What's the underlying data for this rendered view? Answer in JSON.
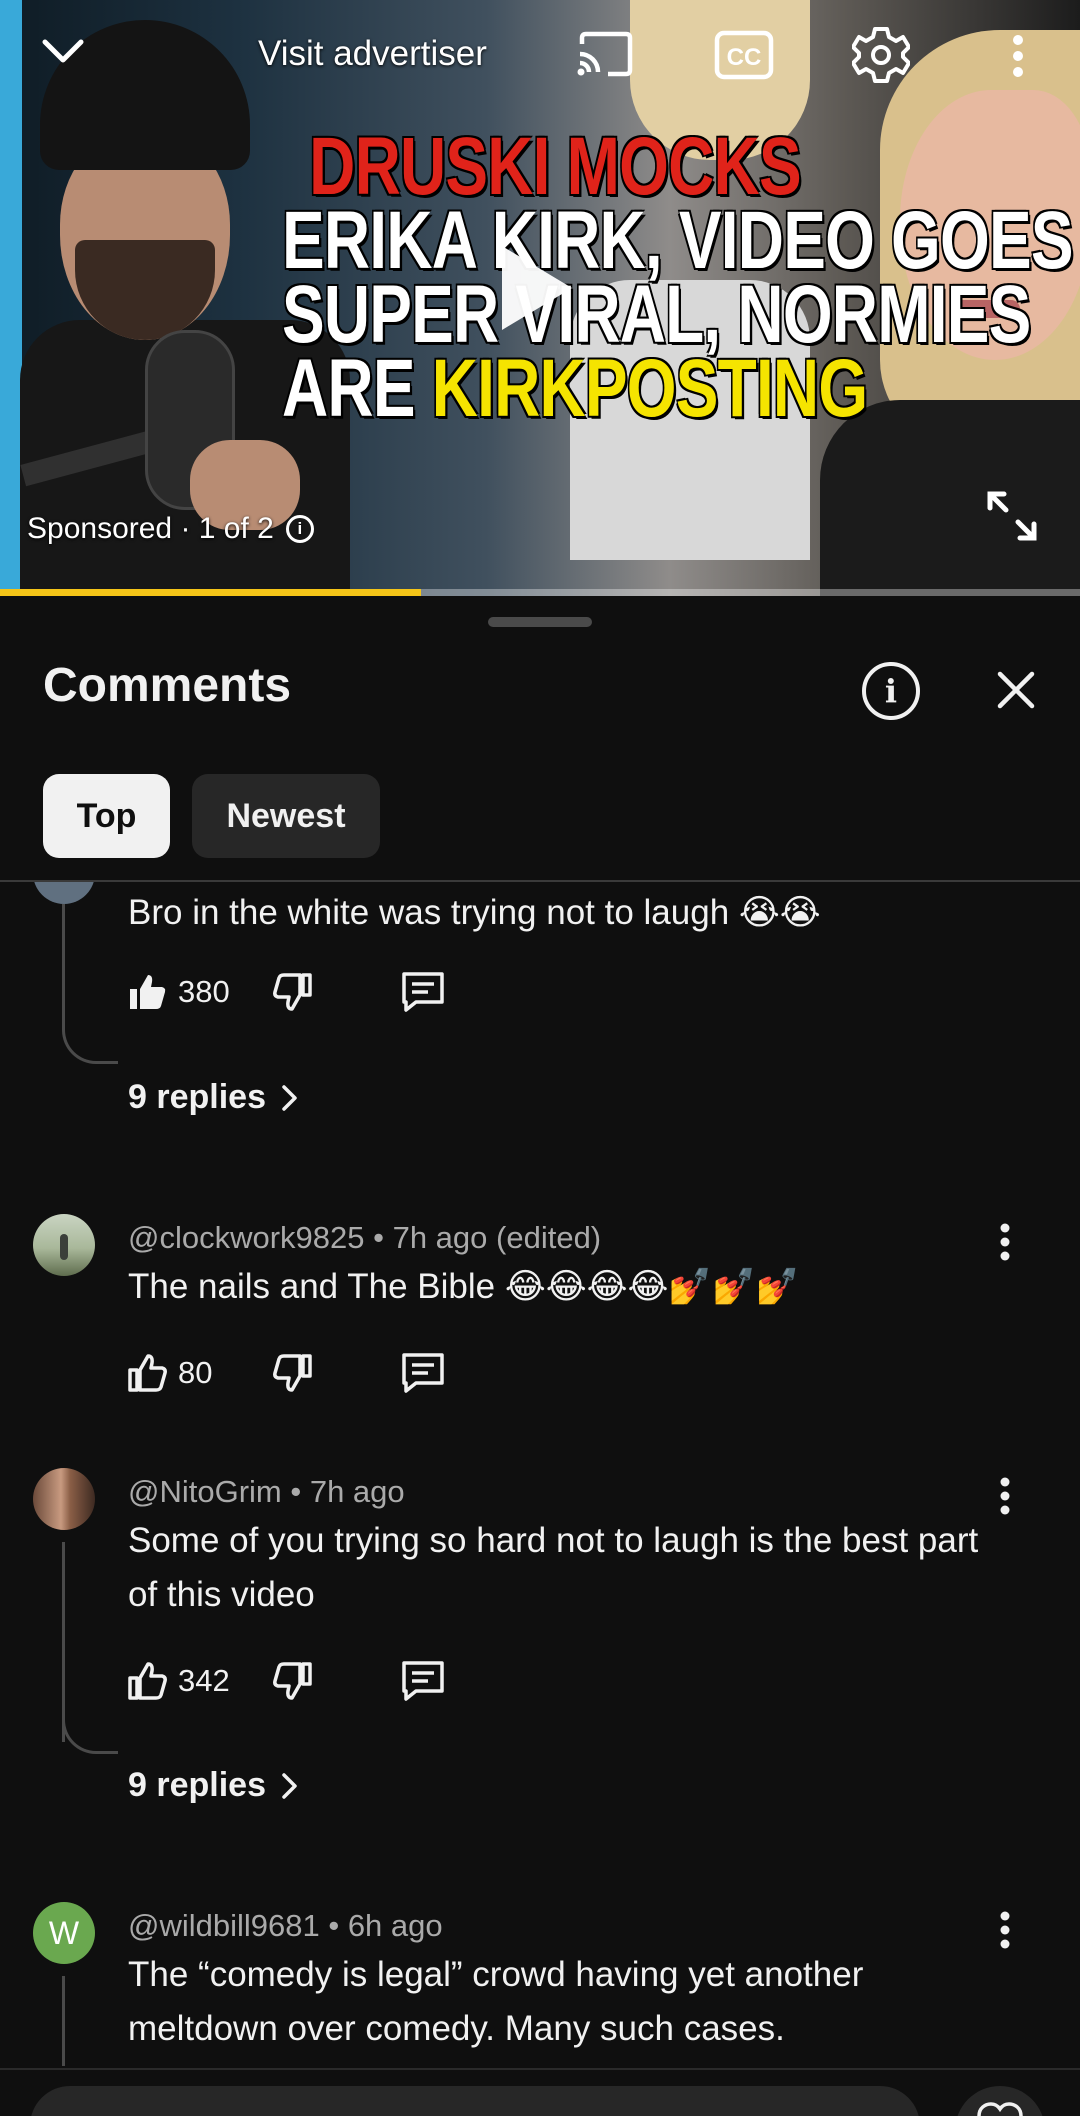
{
  "player": {
    "visit_advertiser": "Visit advertiser",
    "headline": {
      "line1": "DRUSKI MOCKS",
      "line2": "ERIKA KIRK, VIDEO GOES",
      "line3": "SUPER VIRAL, NORMIES",
      "line4_prefix": "ARE ",
      "line4_highlight": "KIRKPOSTING"
    },
    "sponsored": "Sponsored · 1 of 2",
    "progress": 0.39,
    "colors": {
      "progress": "#f5c518",
      "headline_red": "#e0231a",
      "headline_yellow": "#f5e400"
    }
  },
  "panel": {
    "title": "Comments",
    "tabs": [
      {
        "label": "Top",
        "active": true
      },
      {
        "label": "Newest",
        "active": false
      }
    ]
  },
  "comments": [
    {
      "text": "Bro in the white was trying not to laugh 😭😭",
      "likes": "380",
      "replies": "9 replies",
      "liked": true
    },
    {
      "meta": "@clockwork9825 • 7h ago (edited)",
      "text": "The nails and The Bible 😂😂😂😂💅💅💅",
      "likes": "80",
      "liked": false
    },
    {
      "meta": "@NitoGrim • 7h ago",
      "text": "Some of you trying so hard not to laugh is the best part of this video",
      "likes": "342",
      "replies": "9 replies",
      "liked": false
    },
    {
      "meta": "@wildbill9681 • 6h ago",
      "text": "The “comedy is legal” crowd having yet another meltdown over comedy. Many such cases.",
      "avatar_letter": "W",
      "avatar_color": "#6aa84f"
    }
  ]
}
